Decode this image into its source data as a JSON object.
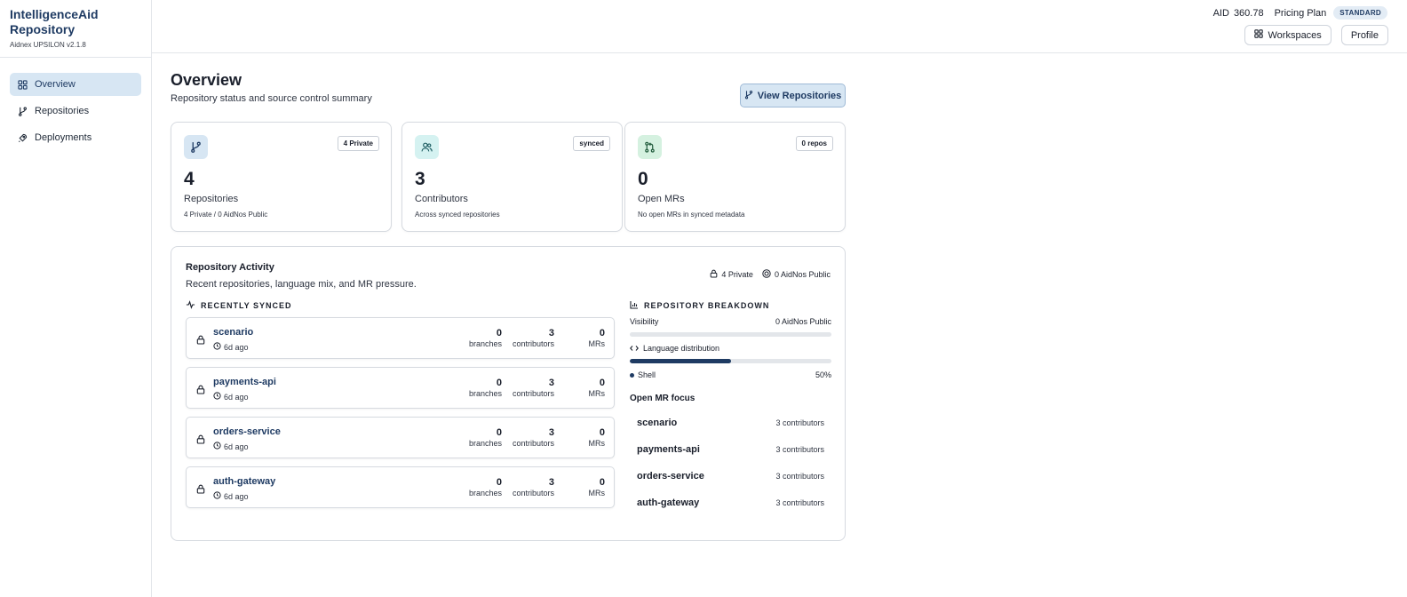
{
  "brand": {
    "title_line1": "IntelligenceAid",
    "title_line2": "Repository",
    "version": "Aidnex UPSILON v2.1.8"
  },
  "sidebar": {
    "items": [
      {
        "label": "Overview",
        "icon": "grid-icon",
        "active": true
      },
      {
        "label": "Repositories",
        "icon": "git-branch-icon",
        "active": false
      },
      {
        "label": "Deployments",
        "icon": "rocket-icon",
        "active": false
      }
    ]
  },
  "topbar": {
    "aid_label": "AID",
    "aid_value": "360.78",
    "plan_label": "Pricing Plan",
    "plan_badge": "STANDARD",
    "workspaces": "Workspaces",
    "profile": "Profile"
  },
  "page": {
    "title": "Overview",
    "subtitle": "Repository status and source control summary",
    "view_button": "View Repositories"
  },
  "cards": [
    {
      "tag": "4 Private",
      "value": "4",
      "label": "Repositories",
      "sub": "4 Private / 0 AidNos Public",
      "icon": "git-branch-icon",
      "color": "#d7e6f3"
    },
    {
      "tag": "synced",
      "value": "3",
      "label": "Contributors",
      "sub": "Across synced repositories",
      "icon": "users-icon",
      "color": "#d5f2f1"
    },
    {
      "tag": "0 repos",
      "value": "0",
      "label": "Open MRs",
      "sub": "No open MRs in synced metadata",
      "icon": "git-pull-request-icon",
      "color": "#d5f1e0"
    }
  ],
  "activity": {
    "title": "Repository Activity",
    "subtitle": "Recent repositories, language mix, and MR pressure.",
    "meta_private": "4 Private",
    "meta_public": "0 AidNos Public",
    "recent_heading": "RECENTLY SYNCED",
    "stat_labels": {
      "branches": "branches",
      "contributors": "contributors",
      "mrs": "MRs"
    },
    "repos": [
      {
        "name": "scenario",
        "time": "6d ago",
        "branches": "0",
        "contributors": "3",
        "mrs": "0"
      },
      {
        "name": "payments-api",
        "time": "6d ago",
        "branches": "0",
        "contributors": "3",
        "mrs": "0"
      },
      {
        "name": "orders-service",
        "time": "6d ago",
        "branches": "0",
        "contributors": "3",
        "mrs": "0"
      },
      {
        "name": "auth-gateway",
        "time": "6d ago",
        "branches": "0",
        "contributors": "3",
        "mrs": "0"
      }
    ],
    "breakdown": {
      "heading": "REPOSITORY BREAKDOWN",
      "visibility_label": "Visibility",
      "visibility_value": "0 AidNos Public",
      "visibility_fraction": 0,
      "language_label": "Language distribution",
      "language_fraction": 0.5,
      "language_name": "Shell",
      "language_pct": "50%",
      "focus_title": "Open MR focus",
      "focus": [
        {
          "name": "scenario",
          "count": "3 contributors"
        },
        {
          "name": "payments-api",
          "count": "3 contributors"
        },
        {
          "name": "orders-service",
          "count": "3 contributors"
        },
        {
          "name": "auth-gateway",
          "count": "3 contributors"
        }
      ]
    }
  }
}
